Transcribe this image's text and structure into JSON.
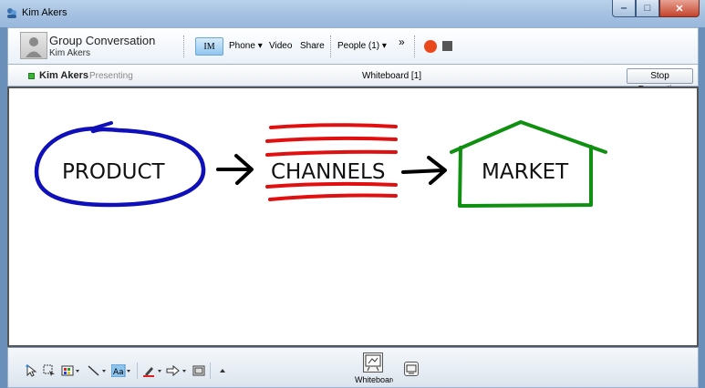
{
  "window": {
    "title": "Kim Akers"
  },
  "header": {
    "conversation_title": "Group Conversation",
    "participant": "Kim Akers",
    "toolbar": {
      "im": "IM",
      "phone": "Phone",
      "video": "Video",
      "share": "Share",
      "people": "People (1)",
      "more": "»"
    }
  },
  "stage": {
    "presenter_name": "Kim Akers",
    "presenter_status": "Presenting",
    "title": "Whiteboard [1]",
    "stop_button": "Stop Presenting"
  },
  "whiteboard": {
    "words": [
      "PRODUCT",
      "CHANNELS",
      "MARKET"
    ],
    "colors": {
      "product": "#1010b8",
      "channels": "#e01010",
      "market": "#109010",
      "arrows": "#000000"
    }
  },
  "bottom": {
    "tab_label": "Whiteboard",
    "tool_icons": [
      "pointer-icon",
      "select-icon",
      "color-grid-icon",
      "line-icon",
      "text-icon",
      "pen-icon",
      "arrow-shape-icon",
      "frame-icon",
      "collapse-icon"
    ]
  },
  "colors": {
    "record": "#e8481c"
  }
}
